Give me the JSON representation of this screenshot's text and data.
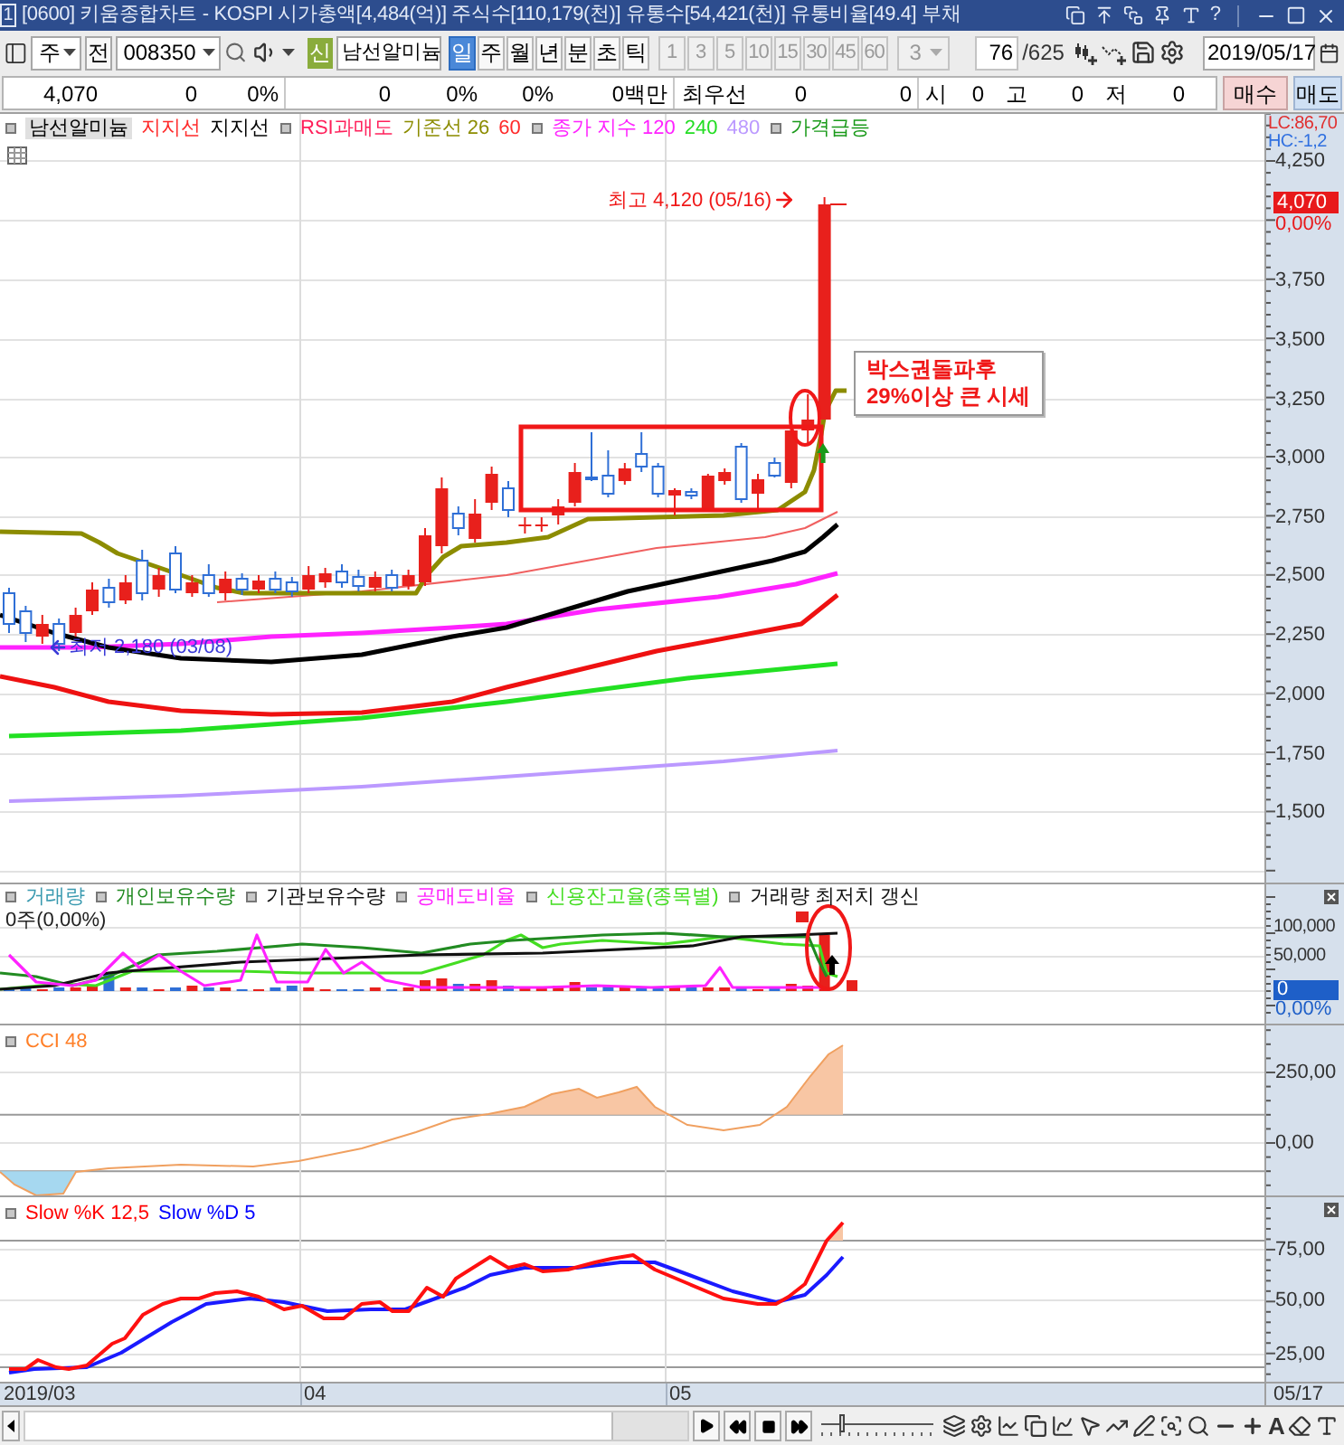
{
  "window": {
    "screen_number": "1",
    "title": "[0600] 키움종합차트 - KOSPI 시가총액[4,484(억)] 주식수[110,179(천)] 유통수[54,421(천)] 유통비율[49.4] 부채",
    "help": "?"
  },
  "toolbar": {
    "market": "주",
    "prev_button": "전",
    "code": "008350",
    "badge": "신",
    "stock_name": "남선알미늄",
    "periods": [
      {
        "label": "일",
        "selected": true
      },
      {
        "label": "주",
        "selected": false
      },
      {
        "label": "월",
        "selected": false
      },
      {
        "label": "년",
        "selected": false
      },
      {
        "label": "분",
        "selected": false
      },
      {
        "label": "초",
        "selected": false
      },
      {
        "label": "틱",
        "selected": false
      }
    ],
    "intervals": [
      {
        "label": "1",
        "disabled": true
      },
      {
        "label": "3",
        "disabled": true
      },
      {
        "label": "5",
        "disabled": true
      },
      {
        "label": "10",
        "disabled": true
      },
      {
        "label": "15",
        "disabled": true
      },
      {
        "label": "30",
        "disabled": true
      },
      {
        "label": "45",
        "disabled": true
      },
      {
        "label": "60",
        "disabled": true
      }
    ],
    "interval_dropdown": {
      "value": "3",
      "disabled": true
    },
    "bar_count": "76",
    "bar_total": "/625",
    "date": "2019/05/17"
  },
  "quote_bar": {
    "cells": [
      {
        "text": "4,070",
        "kind": "value"
      },
      {
        "text": "0",
        "kind": "value"
      },
      {
        "text": "0%",
        "kind": "value"
      },
      {
        "text": "0",
        "kind": "value"
      },
      {
        "text": "0%",
        "kind": "value"
      },
      {
        "text": "0%",
        "kind": "value"
      },
      {
        "text": "0백만",
        "kind": "value"
      },
      {
        "text": "최우선",
        "kind": "label"
      },
      {
        "text": "0",
        "kind": "value"
      },
      {
        "text": "0",
        "kind": "value"
      },
      {
        "text": "시",
        "kind": "label"
      },
      {
        "text": "0",
        "kind": "value"
      },
      {
        "text": "고",
        "kind": "label"
      },
      {
        "text": "0",
        "kind": "value"
      },
      {
        "text": "저",
        "kind": "label"
      },
      {
        "text": "0",
        "kind": "value"
      }
    ],
    "buy_button": "매수",
    "sell_button": "매도"
  },
  "price_chart": {
    "legend": [
      {
        "items": [
          {
            "text": "남선알미늄",
            "kind": "boxed",
            "color": "#000000"
          },
          {
            "text": "지지선",
            "kind": "plain",
            "color": "#ff2a2a"
          },
          {
            "text": "지지선",
            "kind": "plain",
            "color": "#000000"
          }
        ]
      },
      {
        "items": [
          {
            "text": "RSI과매도",
            "kind": "plain",
            "color": "#ff1f5a"
          },
          {
            "text": "기준선 26",
            "kind": "plain",
            "color": "#8c8c00"
          },
          {
            "text": "60",
            "kind": "plain",
            "color": "#ff2a2a"
          }
        ]
      },
      {
        "items": [
          {
            "text": "종가 지수 120",
            "kind": "plain",
            "color": "#ff22ff"
          },
          {
            "text": "240",
            "kind": "plain",
            "color": "#22dd22"
          },
          {
            "text": "480",
            "kind": "plain",
            "color": "#bb99ff"
          }
        ]
      },
      {
        "items": [
          {
            "text": "가격급등",
            "kind": "plain",
            "color": "#1a9a1a"
          }
        ]
      }
    ],
    "axis_header": [
      {
        "text": "LC:86,70",
        "color": "#e03030"
      },
      {
        "text": "HC:-1,2",
        "color": "#3070e0"
      }
    ],
    "y_ticks": [
      "4,250",
      "3,750",
      "3,500",
      "3,250",
      "3,000",
      "2,750",
      "2,500",
      "2,250",
      "2,000",
      "1,750",
      "1,500"
    ],
    "price_tag": "4,070",
    "price_change": "0,00%",
    "high_note": "최고 4,120 (05/16)",
    "low_note": "최저 2,180 (03/08)",
    "callout": [
      "박스권돌파후",
      "29%이상 큰 시세"
    ]
  },
  "volume_chart": {
    "legend": [
      {
        "items": [
          {
            "text": "거래량",
            "color": "#3a9ab0"
          }
        ]
      },
      {
        "items": [
          {
            "text": "개인보유수량",
            "color": "#228b22"
          }
        ]
      },
      {
        "items": [
          {
            "text": "기관보유수량",
            "color": "#111111"
          }
        ]
      },
      {
        "items": [
          {
            "text": "공매도비율",
            "color": "#ff22ff"
          }
        ]
      },
      {
        "items": [
          {
            "text": "신용잔고율(종목별)",
            "color": "#44dd22"
          }
        ]
      },
      {
        "items": [
          {
            "text": "거래량 최저치 갱신",
            "color": "#111111"
          }
        ]
      }
    ],
    "summary": "0주(0,00%)",
    "y_ticks": [
      "100,000",
      "50,000"
    ],
    "value_tag": "0",
    "value_change": "0,00%"
  },
  "cci_chart": {
    "legend": [
      {
        "items": [
          {
            "text": "CCI 48",
            "color": "#ff7f27"
          }
        ]
      }
    ],
    "y_ticks": [
      "250,00",
      "0,00"
    ]
  },
  "stochastic_chart": {
    "legend": [
      {
        "items": [
          {
            "text": "Slow %K 12,5",
            "color": "#ff0000"
          },
          {
            "text": "Slow %D 5",
            "color": "#0000ff"
          }
        ]
      }
    ],
    "y_ticks": [
      "75,00",
      "50,00",
      "25,00"
    ]
  },
  "x_axis": {
    "labels": [
      "2019/03",
      "04",
      "05"
    ],
    "end_date": "05/17"
  },
  "bottom_toolbar": {
    "zoom_slider": {
      "level": 0.17
    },
    "font_button": "A"
  }
}
